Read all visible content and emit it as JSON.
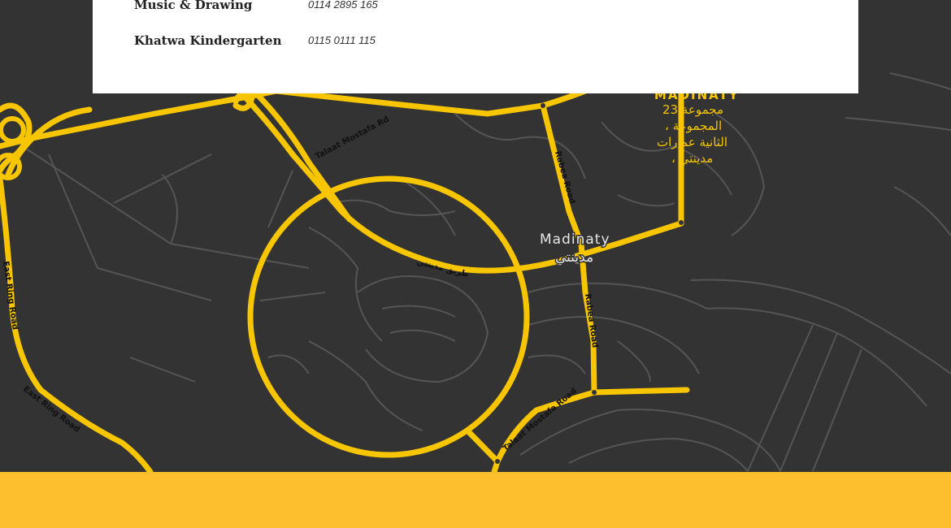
{
  "contacts": [
    {
      "name": "Music & Drawing",
      "phone": "0114 2895 165"
    },
    {
      "name": "Khatwa Kindergarten",
      "phone": "0115 0111 115"
    }
  ],
  "map": {
    "place_label_en": "Madinaty",
    "place_label_ar": "مدينتي",
    "district_label_en": "MADINATY",
    "district_label_ar_lines": [
      "مجموعة 23",
      "، المجموعة",
      "الثانية عمارات",
      "، مدينتي"
    ],
    "roads": {
      "talaat_mostafa_rd_1": "Talaat Mostafa Rd",
      "talaat_mostafa_rd_2": "Talaat Mostafa Road",
      "rabea_road_1": "Rabea Road",
      "rabea_road_2": "Rabea Road",
      "east_ring_road_1": "East Ring Road",
      "east_ring_road_2": "East Ring Road",
      "madinaty_road_ar": "طريق مدينتي"
    },
    "colors": {
      "background": "#333333",
      "road_major": "#f7c600",
      "road_minor": "#5a5a5a",
      "label": "#e6e6e6"
    }
  },
  "footer": {
    "color": "#fdbf2d"
  }
}
